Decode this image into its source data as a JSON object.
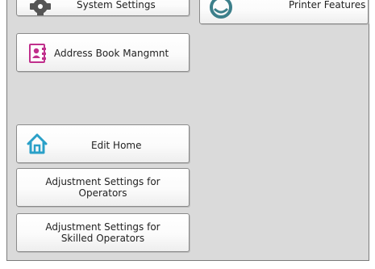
{
  "buttons": {
    "system_settings": "System Settings",
    "printer_features": "Printer Features",
    "address_book": "Address Book Mangmnt",
    "edit_home": "Edit Home",
    "adjust_operators": {
      "line1": "Adjustment Settings for",
      "line2": "Operators"
    },
    "adjust_skilled": {
      "line1": "Adjustment Settings for",
      "line2": "Skilled Operators"
    }
  },
  "icons": {
    "system_settings": "gear-icon",
    "printer_features": "printer-features-icon",
    "address_book": "address-book-icon",
    "edit_home": "home-icon"
  },
  "colors": {
    "background": "#dadada",
    "address_book_icon": "#c0308c",
    "home_icon": "#2aa0c8",
    "printer_icon": "#3c7f8a"
  }
}
